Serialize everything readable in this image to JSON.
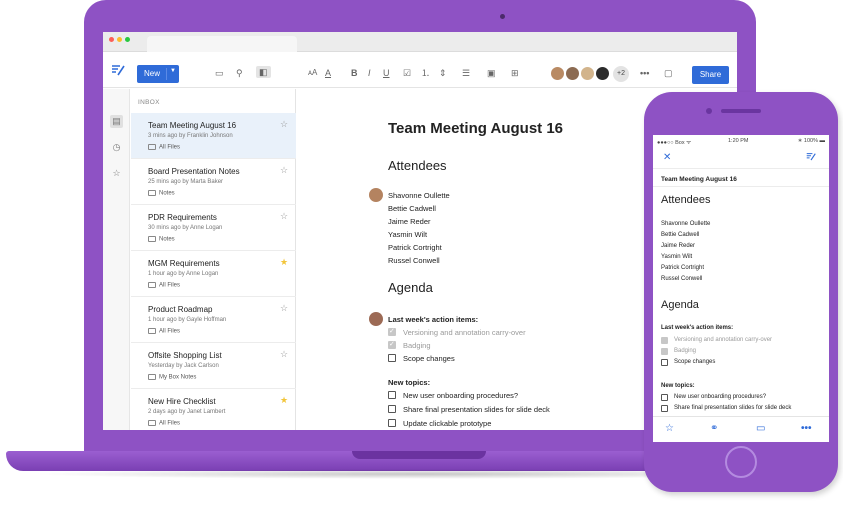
{
  "colors": {
    "brand": "#8e52c4",
    "accent": "#2f6bd8",
    "favorite": "#f2c53a"
  },
  "toolbar": {
    "new_label": "New",
    "more_collaborators": "+2",
    "share_label": "Share",
    "icons": [
      "folder-icon",
      "search-icon",
      "sidebar-toggle-icon",
      "font-size-icon",
      "text-color-icon",
      "bold-icon",
      "italic-icon",
      "underline-icon",
      "checklist-icon",
      "numbered-list-icon",
      "bullet-list-icon",
      "image-icon",
      "table-icon",
      "more-icon",
      "comment-icon"
    ]
  },
  "inbox": {
    "label": "INBOX",
    "items": [
      {
        "title": "Team Meeting August 16",
        "meta": "3 mins ago by Franklin Johnson",
        "folder": "All Files",
        "favorite": false,
        "selected": true
      },
      {
        "title": "Board Presentation Notes",
        "meta": "25 mins ago by Marta Baker",
        "folder": "Notes",
        "favorite": false,
        "selected": false
      },
      {
        "title": "PDR Requirements",
        "meta": "30 mins ago by Anne Logan",
        "folder": "Notes",
        "favorite": false,
        "selected": false
      },
      {
        "title": "MGM Requirements",
        "meta": "1 hour ago by Anne Logan",
        "folder": "All Files",
        "favorite": true,
        "selected": false
      },
      {
        "title": "Product Roadmap",
        "meta": "1 hour ago by Gayle Hoffman",
        "folder": "All Files",
        "favorite": false,
        "selected": false
      },
      {
        "title": "Offsite Shopping List",
        "meta": "Yesterday by Jack Carlson",
        "folder": "My Box Notes",
        "favorite": false,
        "selected": false
      },
      {
        "title": "New Hire Checklist",
        "meta": "2 days ago by Janet Lambert",
        "folder": "All Files",
        "favorite": true,
        "selected": false
      }
    ]
  },
  "document": {
    "title": "Team Meeting August 16",
    "attendees_heading": "Attendees",
    "attendees": [
      "Shavonne Oullette",
      "Bettie Cadwell",
      "Jaime Reder",
      "Yasmin Wilt",
      "Patrick Cortright",
      "Russel Conwell"
    ],
    "agenda_heading": "Agenda",
    "last_week_label": "Last week's action items:",
    "last_week_items": [
      {
        "text": "Versioning and annotation carry-over",
        "done": true
      },
      {
        "text": "Badging",
        "done": true
      },
      {
        "text": "Scope changes",
        "done": false
      }
    ],
    "new_topics_label": "New topics:",
    "new_topics": [
      {
        "text": "New user onboarding procedures?",
        "done": false
      },
      {
        "text": "Share final presentation slides for slide deck",
        "done": false
      },
      {
        "text": "Update clickable prototype",
        "done": false
      }
    ]
  },
  "phone": {
    "status": {
      "carrier": "●●●○○ Box ᯤ",
      "time": "1:20 PM",
      "battery": "∗ 100% ▬"
    },
    "doc_title": "Team Meeting August 16",
    "attendees_heading": "Attendees",
    "attendees": [
      "Shavonne Oullette",
      "Bettie Cadwell",
      "Jaime Reder",
      "Yasmin Wilt",
      "Patrick Cortright",
      "Russel Conwell"
    ],
    "agenda_heading": "Agenda",
    "last_week_label": "Last week's action items:",
    "last_week_items": [
      {
        "text": "Versioning and annotation carry-over",
        "done": true
      },
      {
        "text": "Badging",
        "done": true
      },
      {
        "text": "Scope changes",
        "done": false
      }
    ],
    "new_topics_label": "New topics:",
    "new_topics": [
      {
        "text": "New user onboarding procedures?",
        "done": false
      },
      {
        "text": "Share final presentation slides for slide deck",
        "done": false
      }
    ]
  }
}
